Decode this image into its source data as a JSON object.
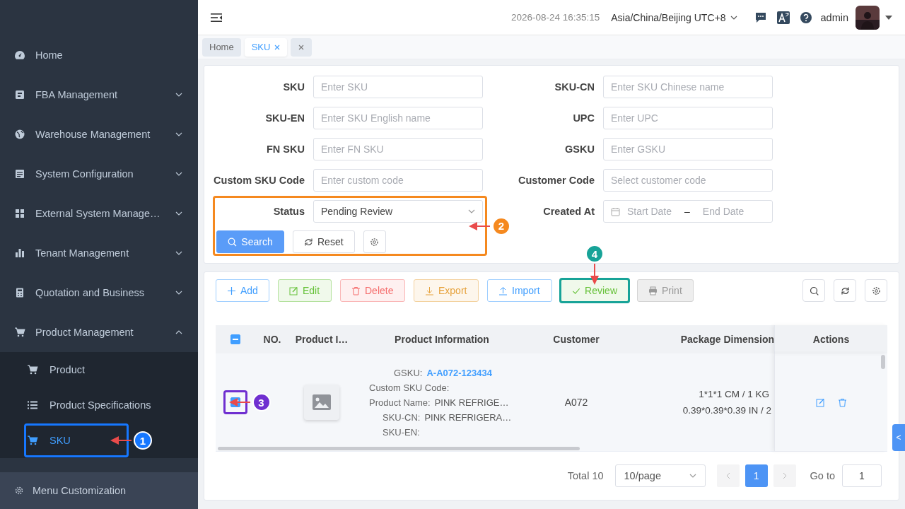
{
  "sidebar": {
    "items": [
      {
        "label": "Home",
        "kind": "link"
      },
      {
        "label": "FBA Management",
        "kind": "group",
        "expanded": false
      },
      {
        "label": "Warehouse Management",
        "kind": "group",
        "expanded": false
      },
      {
        "label": "System Configuration",
        "kind": "group",
        "expanded": false
      },
      {
        "label": "External System Manage…",
        "kind": "group",
        "expanded": false
      },
      {
        "label": "Tenant Management",
        "kind": "group",
        "expanded": false
      },
      {
        "label": "Quotation and Business",
        "kind": "group",
        "expanded": false
      },
      {
        "label": "Product Management",
        "kind": "group",
        "expanded": true,
        "children": [
          {
            "label": "Product",
            "selected": false
          },
          {
            "label": "Product Specifications",
            "selected": false
          },
          {
            "label": "SKU",
            "selected": true,
            "annotation": {
              "number": "1",
              "color": "#1677ff",
              "kind": "right"
            }
          }
        ]
      }
    ],
    "footer": "Menu Customization"
  },
  "header": {
    "datetime": "2026-08-24 16:35:15",
    "timezone": "Asia/China/Beijing UTC+8",
    "user": "admin"
  },
  "tabs": [
    {
      "label": "Home",
      "selected": false,
      "closable": false
    },
    {
      "label": "SKU",
      "selected": true,
      "closable": true
    }
  ],
  "search_form": {
    "fields": [
      {
        "label": "SKU",
        "placeholder": "Enter SKU",
        "kind": "input"
      },
      {
        "label": "SKU-CN",
        "placeholder": "Enter SKU Chinese name",
        "kind": "input"
      },
      {
        "label": "SKU-EN",
        "placeholder": "Enter SKU English name",
        "kind": "input"
      },
      {
        "label": "UPC",
        "placeholder": "Enter UPC",
        "kind": "input"
      },
      {
        "label": "FN SKU",
        "placeholder": "Enter FN SKU",
        "kind": "input"
      },
      {
        "label": "GSKU",
        "placeholder": "Enter GSKU",
        "kind": "input"
      },
      {
        "label": "Custom SKU Code",
        "placeholder": "Enter custom code",
        "kind": "input"
      },
      {
        "label": "Customer Code",
        "placeholder": "Select customer code",
        "kind": "input"
      },
      {
        "label": "Status",
        "value": "Pending Review",
        "kind": "select",
        "annotation": {
          "number": "2",
          "color": "#f5891f",
          "kind": "right"
        }
      },
      {
        "label": "Created At",
        "start_placeholder": "Start Date",
        "separator": "–",
        "end_placeholder": "End Date",
        "kind": "daterange"
      }
    ],
    "buttons": [
      {
        "label": "Search",
        "kind": "primary"
      },
      {
        "label": "Reset",
        "kind": "reset"
      },
      {
        "kind": "settings"
      }
    ]
  },
  "toolbar": {
    "buttons": [
      {
        "label": "Add",
        "kind": "add"
      },
      {
        "label": "Edit",
        "kind": "edit"
      },
      {
        "label": "Delete",
        "kind": "delete"
      },
      {
        "label": "Export",
        "kind": "export"
      },
      {
        "label": "Import",
        "kind": "import"
      },
      {
        "label": "Review",
        "kind": "review",
        "annotation": {
          "number": "4",
          "color": "#17a398",
          "kind": "above"
        }
      },
      {
        "label": "Print",
        "kind": "print"
      }
    ]
  },
  "table": {
    "header_checkbox": {
      "indeterminate": true
    },
    "columns": [
      "NO.",
      "Product I…",
      "Product Information",
      "Customer",
      "Package Dimension",
      "Actions"
    ],
    "rows": [
      {
        "selected": true,
        "annotation": {
          "number": "3",
          "color": "#6f2fd0",
          "kind": "right"
        },
        "image": {
          "kind": "picture"
        },
        "info": [
          {
            "label": "GSKU:",
            "value": "A-A072-123434",
            "link": true
          },
          {
            "label": "Custom SKU Code:"
          },
          {
            "label": "Product Name:",
            "value": "PINK REFRIGE…",
            "link": false
          },
          {
            "label": "SKU-CN:",
            "value": "PINK REFRIGERA…",
            "link": false
          },
          {
            "label": "SKU-EN:"
          }
        ],
        "customer": "A072",
        "package": [
          "1*1*1 CM / 1 KG",
          "0.39*0.39*0.39 IN / 2"
        ]
      }
    ]
  },
  "pagination": {
    "total": "Total 10",
    "page_size": "10/page",
    "pages": [
      {
        "label": "1",
        "selected": true
      }
    ],
    "goto_label": "Go to",
    "goto_value": "1"
  },
  "side_tab": "<"
}
